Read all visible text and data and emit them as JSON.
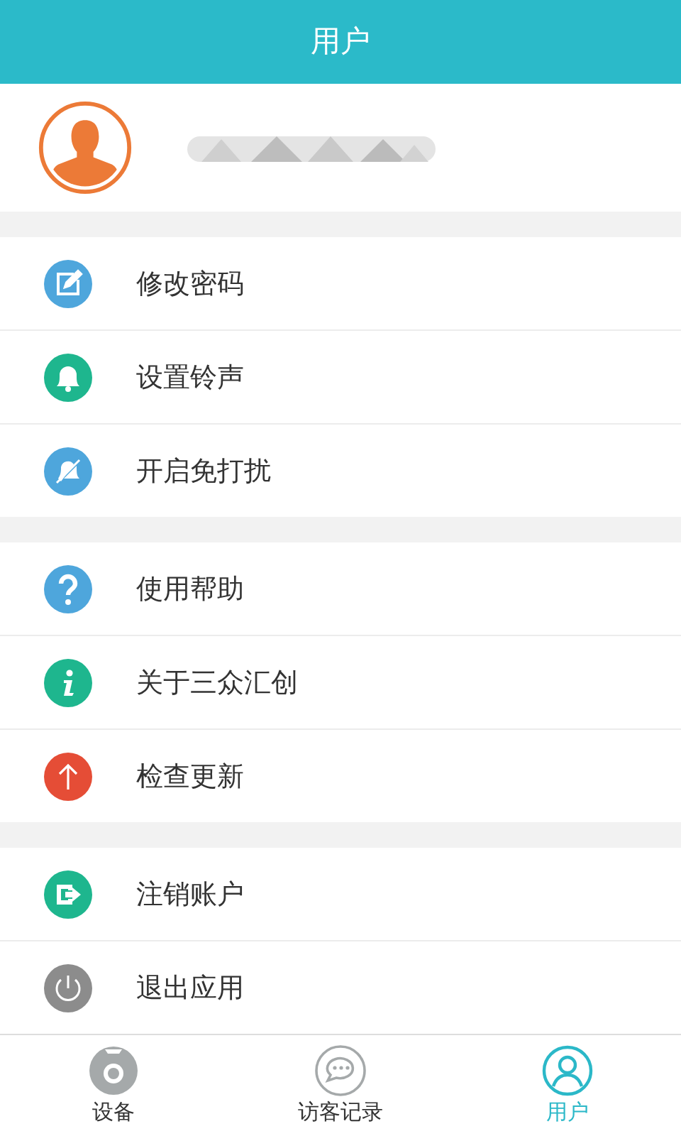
{
  "header": {
    "title": "用户"
  },
  "profile": {
    "name_hidden": true
  },
  "groups": [
    [
      {
        "label": "修改密码",
        "kind": "edit",
        "color": "#4ea6dc"
      },
      {
        "label": "设置铃声",
        "kind": "bell",
        "color": "#1eb68e"
      },
      {
        "label": "开启免打扰",
        "kind": "mute",
        "color": "#4ea6dc"
      }
    ],
    [
      {
        "label": "使用帮助",
        "kind": "help",
        "color": "#4ea6dc"
      },
      {
        "label": "关于三众汇创",
        "kind": "info",
        "color": "#1eb68e"
      },
      {
        "label": "检查更新",
        "kind": "update",
        "color": "#e54d36"
      }
    ],
    [
      {
        "label": "注销账户",
        "kind": "logout",
        "color": "#1eb68e"
      },
      {
        "label": "退出应用",
        "kind": "power",
        "color": "#8c8c8c"
      }
    ]
  ],
  "tabs": [
    {
      "label": "设备",
      "kind": "camera",
      "selected": false
    },
    {
      "label": "访客记录",
      "kind": "chat",
      "selected": false
    },
    {
      "label": "用户",
      "kind": "user",
      "selected": true
    }
  ]
}
